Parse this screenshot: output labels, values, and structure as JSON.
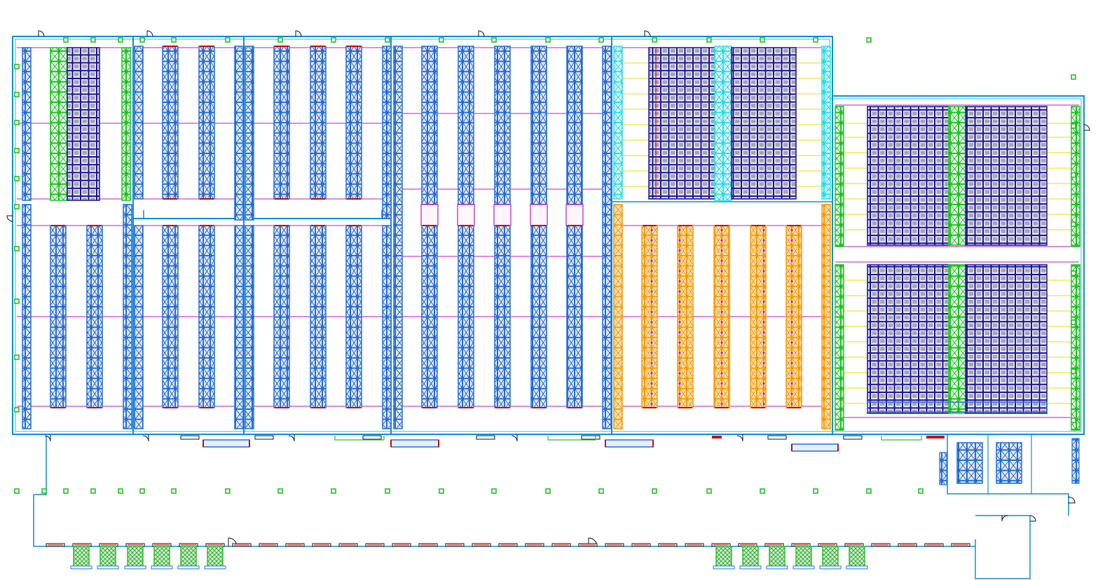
{
  "drawing": {
    "background": "#ffffff",
    "colors": {
      "wall": "#0b8fd6",
      "wall_cyan": "#18c8e6",
      "rack_blue": "#1e6fe0",
      "rack_blue_fill": "#d8ecff",
      "rack_x": "#2a2a8a",
      "rack_green": "#19c81e",
      "rack_cyan": "#22e6ee",
      "rack_orange": "#ff9a00",
      "rack_orange_fill": "#ffe2a8",
      "shelf_navy": "#17119a",
      "shelf_fill": "#ececf6",
      "box_gray": "#a5a5ad",
      "sprinkler_magenta": "#c317c3",
      "sprinkler_yellow": "#e6e200",
      "column_green": "#10c010",
      "door_black": "#111111",
      "dock_red": "#d40000",
      "pad_green": "#33bb33"
    },
    "zones": [
      {
        "id": "west-selective-racking",
        "rack_color": "blue"
      },
      {
        "id": "west-shelving-block",
        "rack_color": "green"
      },
      {
        "id": "center-selective-racking",
        "rack_color": "blue"
      },
      {
        "id": "north-east-shelving",
        "rack_color": "cyan"
      },
      {
        "id": "south-east-racking",
        "rack_color": "orange"
      },
      {
        "id": "far-east-shelving",
        "rack_color": "green"
      },
      {
        "id": "dock-yard",
        "rack_color": "none"
      }
    ]
  }
}
